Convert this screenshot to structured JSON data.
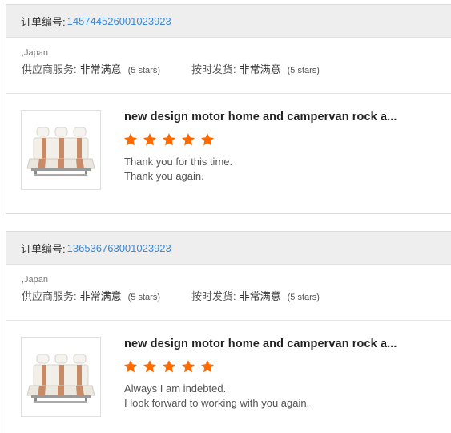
{
  "colors": {
    "link": "#3a8ad6",
    "star": "#ff6a00",
    "header_bg": "#eeeeee"
  },
  "reviews": [
    {
      "order_label": "订单编号:",
      "order_number": "145744526001023923",
      "country": ",Japan",
      "supplier_service_label": "供应商服务:",
      "supplier_service_value": "非常满意",
      "supplier_service_stars": "(5 stars)",
      "on_time_label": "按时发货:",
      "on_time_value": "非常满意",
      "on_time_stars": "(5 stars)",
      "product_title": "new design motor home and campervan rock a...",
      "product_icon": "car-seat-bench-image",
      "rating": 5,
      "comment_lines": [
        "Thank you for this time.",
        "Thank you again."
      ]
    },
    {
      "order_label": "订单编号:",
      "order_number": "136536763001023923",
      "country": ",Japan",
      "supplier_service_label": "供应商服务:",
      "supplier_service_value": "非常满意",
      "supplier_service_stars": "(5 stars)",
      "on_time_label": "按时发货:",
      "on_time_value": "非常满意",
      "on_time_stars": "(5 stars)",
      "product_title": "new design motor home and campervan rock a...",
      "product_icon": "car-seat-bench-image",
      "rating": 5,
      "comment_lines": [
        "Always I am indebted.",
        "I look forward to working with you again."
      ]
    }
  ]
}
